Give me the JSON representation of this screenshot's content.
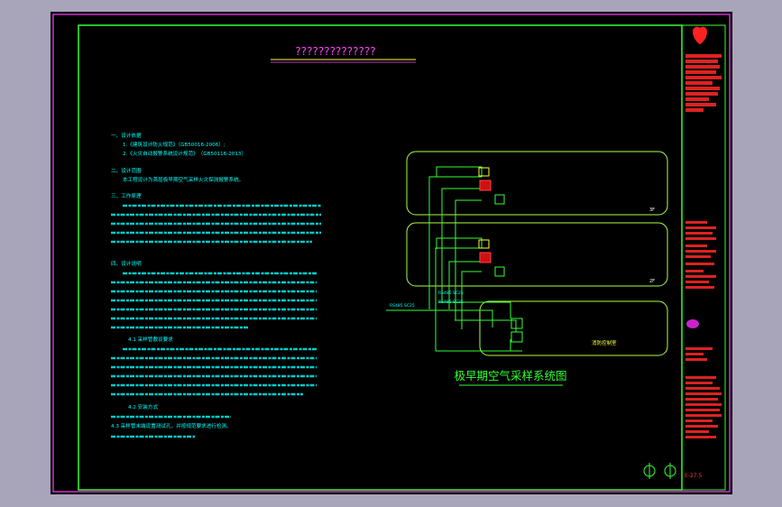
{
  "drawing": {
    "header_title": "??????????????",
    "diagram_title": "极早期空气采样系统图",
    "notes": [
      "一、设计依据",
      "1.《建筑设计防火规范》（GB50016-2006）;",
      "2.《火灾自动报警系统设计规范》　（GB50116-2013）",
      "二、设计范围",
      "本工程设计为首层极早期空气采样火灾探测报警系统。",
      "三、工作原理",
      "四、设计说明",
      "4.1 采样管敷设要求",
      "4.2 安装方式",
      "4.3 采样管末端设置测试孔，并按规范要求进行检测。"
    ],
    "labels": {
      "floor_upper": "3F",
      "floor_lower": "2F",
      "bus_1": "RS485 SC25",
      "bus_2": "RS485 SC25",
      "bus_3": "RS485 SC25",
      "control_room": "消防控制室"
    },
    "title_block": {
      "sheet_no": "E-27.5"
    }
  },
  "colors": {
    "background": "#000000",
    "outer_frame": "#cc33cc",
    "inner_frame": "#33ff33",
    "notes": "#00ffff",
    "titleblock_text": "#ff3333",
    "device": "#ff2222"
  }
}
